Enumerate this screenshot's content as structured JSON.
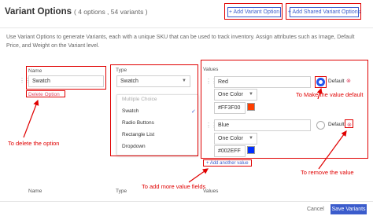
{
  "header": {
    "title": "Variant Options",
    "subtitle": "( 4 options , 54 variants )",
    "add_variant_option": "+ Add Variant Option",
    "add_shared_variant_options": "+ Add Shared Variant Options"
  },
  "description": "Use Variant Options to generate Variants, each with a unique SKU that can be used to track inventory. Assign attributes such as Image, Default Price, and Weight on the Variant level.",
  "columns": {
    "name": "Name",
    "type": "Type",
    "values": "Values"
  },
  "option": {
    "name": "Swatch",
    "delete": "Delete Option",
    "type": "Swatch",
    "type_menu": {
      "header": "Multiple Choice",
      "items": [
        "Swatch",
        "Radio Buttons",
        "Rectangle List",
        "Dropdown"
      ],
      "selected": "Swatch"
    },
    "values": [
      {
        "name": "Red",
        "color_mode": "One Color",
        "hex": "#FF3F00",
        "default_label": "Default",
        "is_default": true
      },
      {
        "name": "Blue",
        "color_mode": "One Color",
        "hex": "#002EFF",
        "default_label": "Default",
        "is_default": false
      }
    ],
    "add_value": "+ Add another value"
  },
  "next_row": {
    "name": "Name",
    "type": "Type",
    "values": "Values"
  },
  "annotations": {
    "delete_option": "To delete the option",
    "default_value": "To Make the value default",
    "add_value_fields": "To add more value fields",
    "remove_value": "To remove the value"
  },
  "footer": {
    "cancel": "Cancel",
    "save": "Save Variants"
  },
  "colors": {
    "accent": "#3b5ccc",
    "annotation": "#e00000",
    "swatch_red": "#FF3F00",
    "swatch_blue": "#002EFF"
  }
}
